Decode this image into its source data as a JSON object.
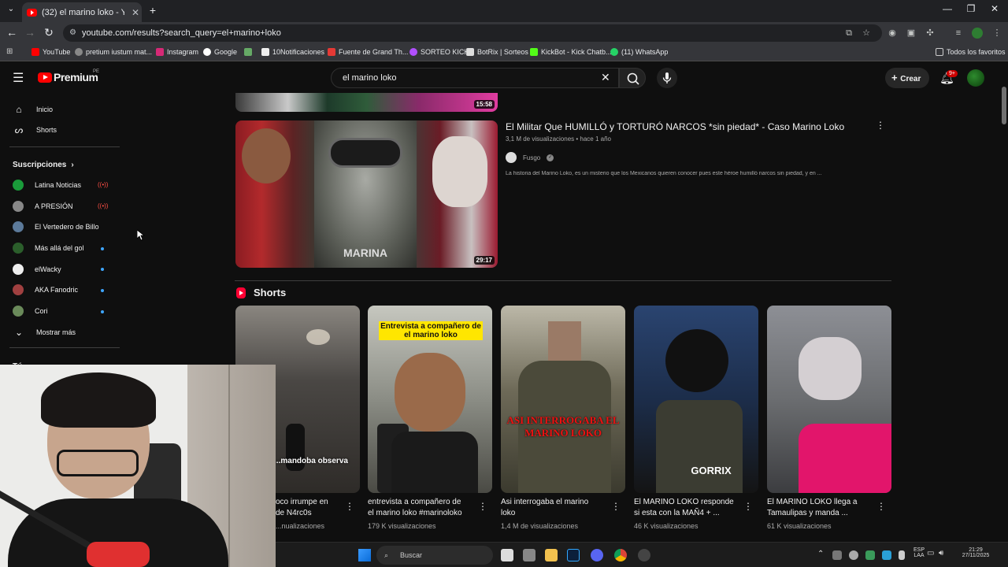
{
  "browser": {
    "tab_title": "(32) el marino loko - YouTube",
    "url": "youtube.com/results?search_query=el+marino+loko",
    "bookmarks": [
      "YouTube",
      "pretium iustum mat...",
      "Instagram",
      "Google",
      "10Notificaciones",
      "Fuente de Grand Th...",
      "SORTEO KICK",
      "BotRix | Sorteos",
      "KickBot - Kick Chatb...",
      "(11) WhatsApp"
    ],
    "all_bookmarks": "Todos los favoritos"
  },
  "masthead": {
    "logo": "Premium",
    "logo_region": "PE",
    "search_query": "el marino loko",
    "create_label": "Crear",
    "notifications": "9+"
  },
  "sidebar": {
    "home": "Inicio",
    "shorts": "Shorts",
    "subscriptions_header": "Suscripciones",
    "subscriptions": [
      {
        "name": "Latina Noticias",
        "color": "#1a9b3a"
      },
      {
        "name": "A PRESIÓN",
        "color": "#888888"
      },
      {
        "name": "El Vertedero de Billo",
        "color": "#5c7a9a"
      },
      {
        "name": "Más allá del gol",
        "color": "#2b5e2b"
      },
      {
        "name": "elWacky",
        "color": "#eeeeee"
      },
      {
        "name": "AKA Fanodric",
        "color": "#a04040"
      },
      {
        "name": "Cori",
        "color": "#6a8a5a"
      }
    ],
    "show_more": "Mostrar más",
    "you_section": "Tú"
  },
  "video": {
    "title": "El Militar Que HUMILLÓ y TORTURÓ NARCOS *sin piedad* - Caso Marino Loko",
    "views": "3,1 M de visualizaciones",
    "age": "hace 1 año",
    "channel": "Fusgo",
    "description": "La historia del Marino Loko, es un misterio que los Mexicanos quieren conocer pues este héroe humilló narcos sin piedad, y en ...",
    "duration": "29:17",
    "thumb_text": "MARINA",
    "prev_duration": "15:58"
  },
  "shorts": {
    "header": "Shorts",
    "items": [
      {
        "title": "...oco irrumpe en ... de N4rc0s",
        "title_l1": "oco irrumpe en",
        "title_l2": "de N4rc0s",
        "views": "...nualizaciones",
        "overlay": "...mandoba observa"
      },
      {
        "title_l1": "entrevista a compañero de",
        "title_l2": "el marino loko #marinoloko",
        "views": "179 K visualizaciones",
        "overlay": "Entrevista a compañero de el marino loko"
      },
      {
        "title_l1": "Asi interrogaba el marino",
        "title_l2": "loko",
        "views": "1,4 M de visualizaciones",
        "overlay": "ASI INTERROGABA EL MARINO LOKO"
      },
      {
        "title_l1": "El MARINO LOKO responde",
        "title_l2": "si esta con la MAÑ4 + ...",
        "views": "46 K visualizaciones",
        "overlay": "GORRIX"
      },
      {
        "title_l1": "El MARINO LOKO llega a",
        "title_l2": "Tamaulipas y manda ...",
        "views": "61 K visualizaciones",
        "overlay": ""
      }
    ]
  },
  "taskbar": {
    "search": "Buscar",
    "lang_1": "ESP",
    "lang_2": "LAA",
    "time": "21:29",
    "date": "27/11/2025"
  }
}
